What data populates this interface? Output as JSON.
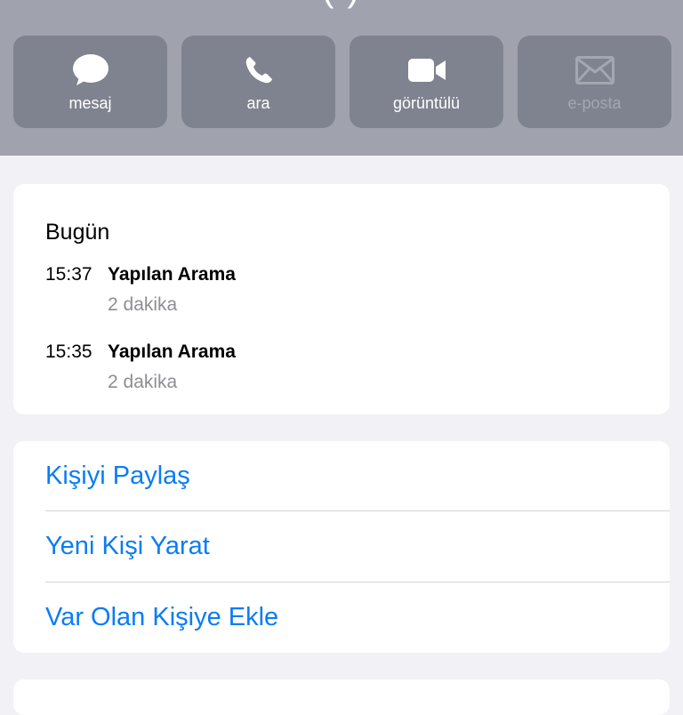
{
  "actions": [
    {
      "label": "mesaj",
      "icon": "message-bubble-icon",
      "enabled": true
    },
    {
      "label": "ara",
      "icon": "phone-icon",
      "enabled": true
    },
    {
      "label": "görüntülü",
      "icon": "video-camera-icon",
      "enabled": true
    },
    {
      "label": "e-posta",
      "icon": "envelope-icon",
      "enabled": false
    }
  ],
  "history": {
    "day": "Bugün",
    "calls": [
      {
        "time": "15:37",
        "type": "Yapılan Arama",
        "duration": "2 dakika"
      },
      {
        "time": "15:35",
        "type": "Yapılan Arama",
        "duration": "2 dakika"
      }
    ]
  },
  "links": [
    "Kişiyi Paylaş",
    "Yeni Kişi Yarat",
    "Var Olan Kişiye Ekle"
  ],
  "colors": {
    "header": "#a0a3ae",
    "action_button": "#7f838f",
    "link": "#0a7cf6",
    "background": "#f1f1f6"
  }
}
